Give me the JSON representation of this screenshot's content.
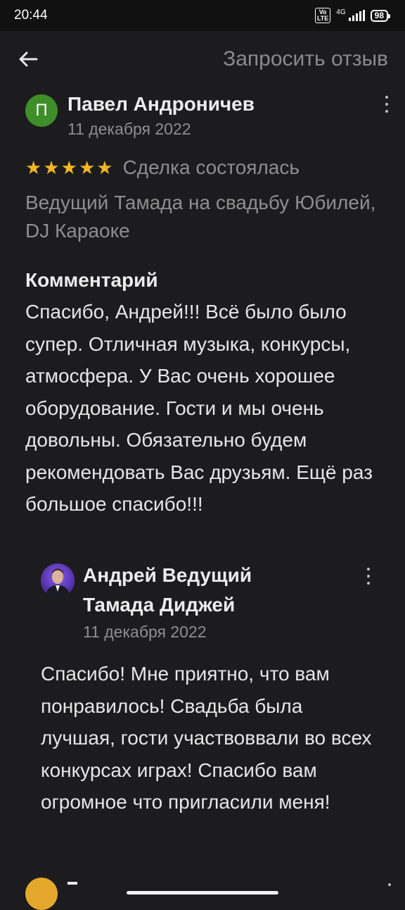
{
  "status_bar": {
    "time": "20:44",
    "network": "4G",
    "volte": "Vo LTE",
    "battery": "98"
  },
  "app_bar": {
    "back_icon": "arrow-left-icon",
    "request_review_label": "Запросить отзыв"
  },
  "review": {
    "avatar_letter": "П",
    "avatar_color": "#3e8e29",
    "author": "Павел Андроничев",
    "date": "11 декабря 2022",
    "rating": 5,
    "stars": [
      "★",
      "★",
      "★",
      "★",
      "★"
    ],
    "deal_status": "Сделка состоялась",
    "service": "Ведущий Тамада на свадьбу Юбилей, DJ Караоке",
    "comment_heading": "Комментарий",
    "comment": "Спасибо, Андрей!!! Всё было было супер. Отличная музыка, конкурсы, атмосфера. У Вас очень хорошее оборудование. Гости и мы очень довольны. Обязательно будем рекомендовать Вас друзьям. Ещё раз большое спасибо!!!"
  },
  "reply": {
    "author": "Андрей Ведущий Тамада Диджей",
    "date": "11 декабря 2022",
    "text": "Спасибо! Мне приятно, что вам понравилось! Свадьба была лучшая, гости участвоввали во всех конкурсах играх! Спасибо вам огромное что пригласили меня!"
  },
  "colors": {
    "background": "#1c1c1e",
    "star": "#f5b623",
    "secondary_text": "#8e8e8e"
  }
}
